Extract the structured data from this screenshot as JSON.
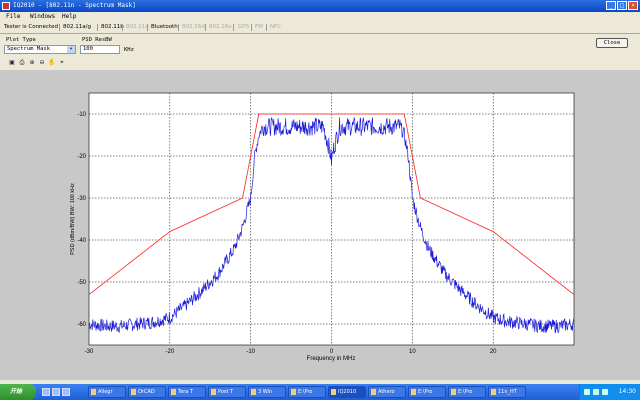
{
  "window": {
    "title": "IQ2010 - [802.11n - Spectrum Mask]"
  },
  "menu": {
    "file": "File",
    "windows": "Windows",
    "help": "Help"
  },
  "tabs": [
    {
      "label": "Tester is Connected",
      "state": "active"
    },
    {
      "label": "802.11a/g",
      "state": "active"
    },
    {
      "label": "802.11b",
      "state": "active"
    },
    {
      "label": "802.11n",
      "state": "dim"
    },
    {
      "label": "Bluetooth",
      "state": "active"
    },
    {
      "label": "802.16d",
      "state": "dim"
    },
    {
      "label": "802.16e",
      "state": "dim"
    },
    {
      "label": "GPS",
      "state": "dim"
    },
    {
      "label": "FM",
      "state": "dim"
    },
    {
      "label": "NFC",
      "state": "dim"
    }
  ],
  "controls": {
    "plot_type_label": "Plot Type",
    "plot_type_value": "Spectrum Mask",
    "psd_res_label": "PSD ResBW",
    "psd_res_value": "100",
    "psd_res_unit": "KHz",
    "close_label": "Close"
  },
  "toolbar_icons": [
    "save-icon",
    "print-icon",
    "zoom-in-icon",
    "zoom-out-icon",
    "pan-icon",
    "data-cursor-icon"
  ],
  "colors": {
    "mask": "#ff2020",
    "spectrum": "#1c1cd8",
    "plot_bg": "#ffffff",
    "frame_bg": "#c8c8c8"
  },
  "chart_data": {
    "type": "line",
    "xlabel": "Frequency in MHz",
    "ylabel": "PSD (dBm/BW) BW: 100 kHz",
    "xlim": [
      -30,
      30
    ],
    "ylim": [
      -65,
      -5
    ],
    "xticks": [
      -30,
      -20,
      -10,
      0,
      10,
      20
    ],
    "yticks": [
      -10,
      -20,
      -30,
      -40,
      -50,
      -60
    ],
    "grid": true,
    "series": [
      {
        "role": "mask",
        "x": [
          -30,
          -20,
          -11,
          -9,
          9,
          11,
          20,
          30
        ],
        "y": [
          -53,
          -38,
          -30,
          -10,
          -10,
          -30,
          -38,
          -53
        ]
      },
      {
        "role": "spectrum",
        "x": [
          -30,
          -28,
          -26,
          -24,
          -22,
          -20,
          -18,
          -16,
          -14,
          -12,
          -11,
          -10,
          -9.5,
          -9,
          -8.5,
          -5,
          -1,
          -0.3,
          0,
          0.3,
          1,
          5,
          8.5,
          9,
          9.5,
          10,
          11,
          12,
          14,
          16,
          18,
          20,
          22,
          24,
          26,
          28,
          30
        ],
        "y": [
          -60,
          -60.5,
          -60.5,
          -60,
          -59.5,
          -58.5,
          -55.5,
          -52,
          -48,
          -42,
          -37,
          -30,
          -20,
          -15,
          -13,
          -13,
          -13,
          -18,
          -21,
          -18,
          -13,
          -13,
          -13,
          -15,
          -20,
          -30,
          -37,
          -42,
          -48,
          -52,
          -55.5,
          -58.5,
          -59.5,
          -60,
          -60.5,
          -60.5,
          -60
        ]
      }
    ]
  },
  "taskbar": {
    "start_label": "开始",
    "items": [
      "Allegr",
      "OrCAD",
      "Tera T",
      "Post T",
      "3 Win",
      "E:\\Pro",
      "IQ2010",
      "Athero",
      "E:\\Pro",
      "E:\\Pro",
      "11n_HT"
    ],
    "clock": "14:30"
  }
}
